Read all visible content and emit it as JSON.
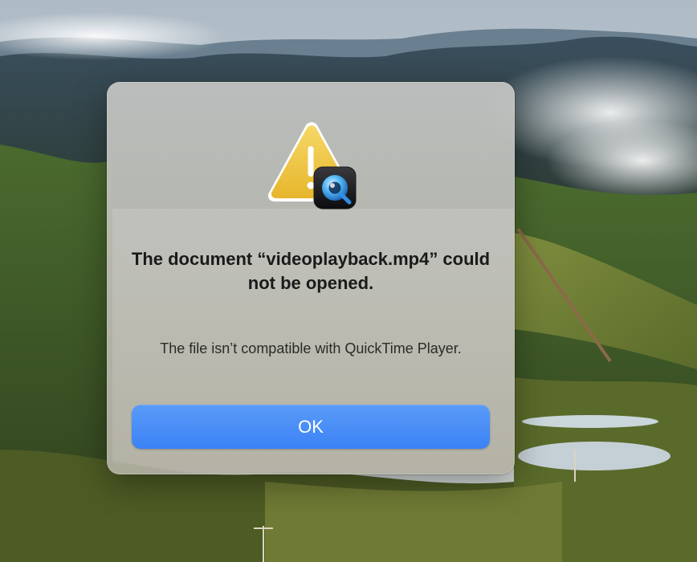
{
  "dialog": {
    "title": "The document “videoplayback.mp4” could not be opened.",
    "message": "The file isn’t compatible with QuickTime Player.",
    "ok_label": "OK",
    "icon": "warning-triangle-icon",
    "badge_icon": "quicktime-icon"
  },
  "colors": {
    "button_accent": "#3b82f5",
    "warning_yellow": "#f2c94c"
  }
}
